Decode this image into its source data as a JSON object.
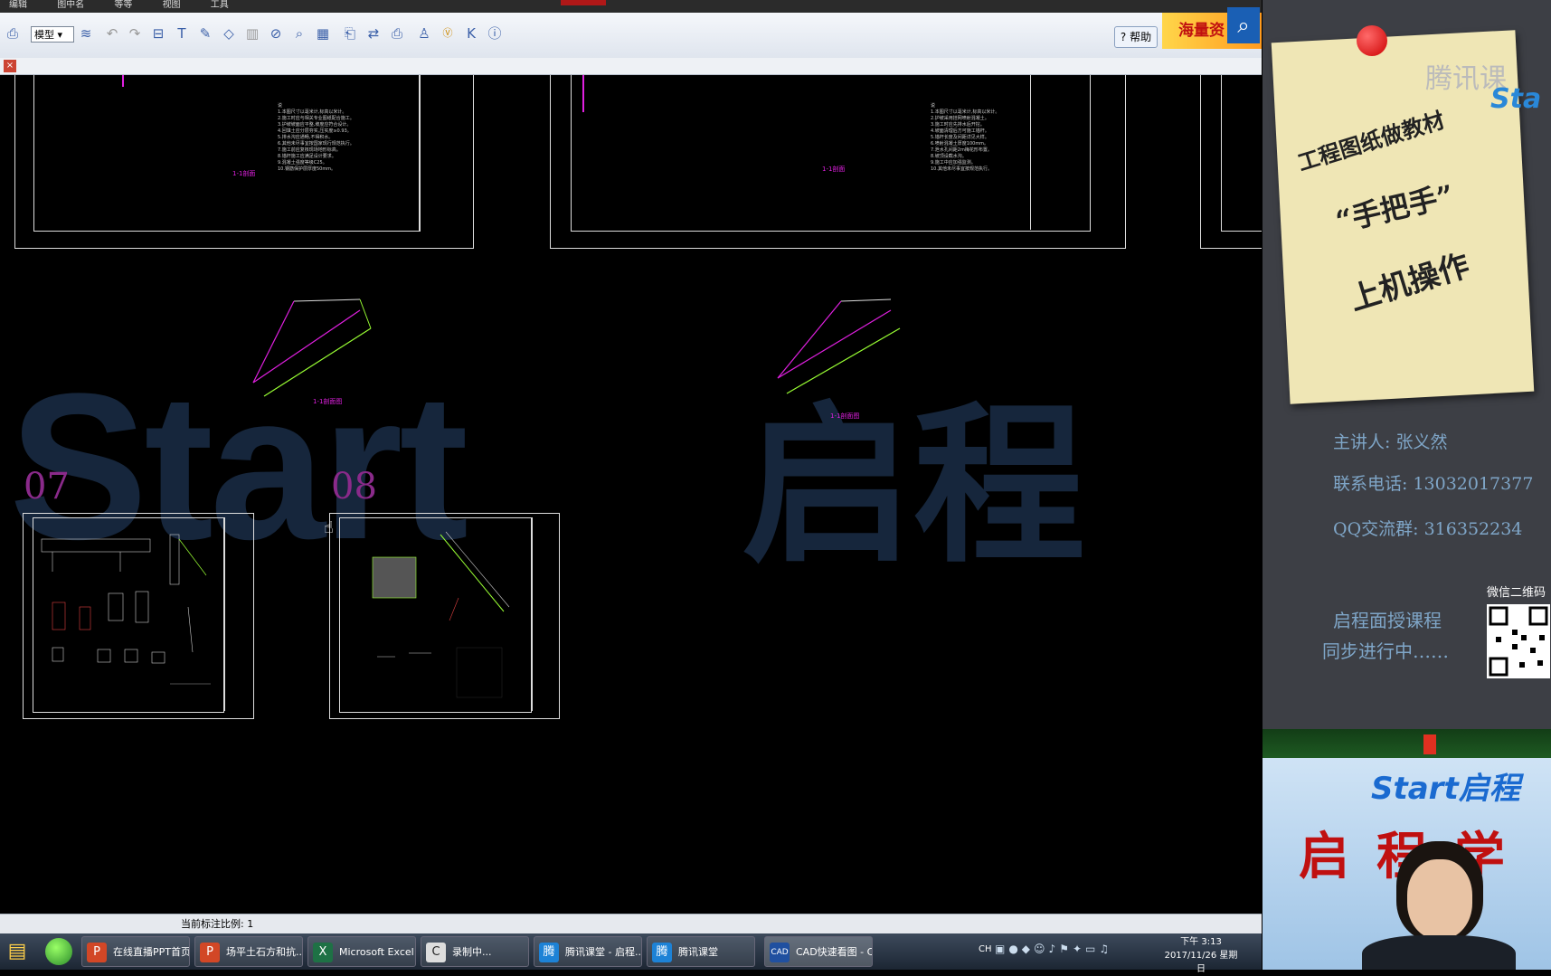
{
  "menubar": {
    "items": [
      "编辑",
      "图中名",
      "等等",
      "视图",
      "工具"
    ]
  },
  "toolbar": {
    "view_mode": "模型",
    "help_label": "帮助",
    "banner_text": "海量资"
  },
  "drawing": {
    "sheet_numbers": [
      "07",
      "08"
    ],
    "magenta_labels": [
      "1-1剖面",
      "1-1剖面",
      "1-1剖面图",
      "1-1剖面图"
    ],
    "watermark_latin": "Start",
    "watermark_cn": "启程"
  },
  "status": {
    "text": "当前标注比例: 1"
  },
  "taskbar": {
    "items": [
      {
        "label": "在线直播PPT首页",
        "icon": "P",
        "color": "#d24726"
      },
      {
        "label": "场平土石方和抗...",
        "icon": "P",
        "color": "#d24726"
      },
      {
        "label": "Microsoft Excel ...",
        "icon": "X",
        "color": "#1e7145"
      },
      {
        "label": "录制中...",
        "icon": "C",
        "color": "#2a2a2a"
      },
      {
        "label": "腾讯课堂 - 启程...",
        "icon": "腾",
        "color": "#1d82d6"
      },
      {
        "label": "腾讯课堂",
        "icon": "腾",
        "color": "#1d82d6"
      },
      {
        "label": "CAD快速看图 - C...",
        "icon": "CAD",
        "color": "#2050a0"
      }
    ],
    "tray_lang": "CH",
    "time": "下午 3:13",
    "date": "2017/11/26 星期日"
  },
  "panel": {
    "note_line1": "工程图纸做教材",
    "note_line2": "“手把手”",
    "note_line3": "上机操作",
    "logo_text": "腾讯课",
    "logo_start": "Sta",
    "teacher": "主讲人: 张义然",
    "phone": "联系电话: 13032017377",
    "qq": "QQ交流群: 316352234",
    "wechat_label": "微信二维码",
    "promo_line1": "启程面授课程",
    "promo_line2": "同步进行中……",
    "webcam_logo": "Start启程",
    "webcam_banner": "启程学"
  }
}
